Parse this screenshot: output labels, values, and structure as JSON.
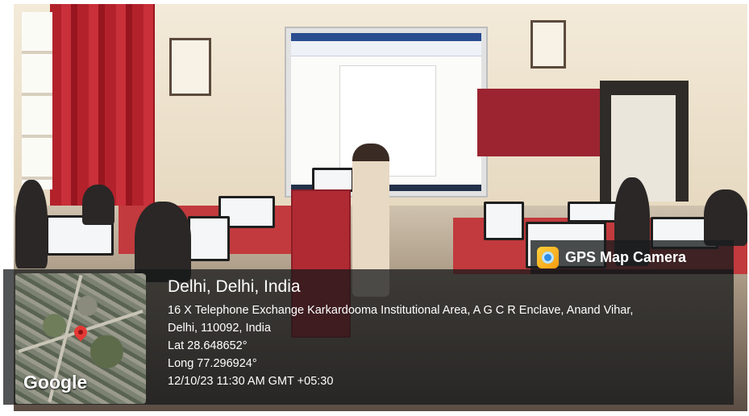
{
  "overlay": {
    "app_name": "GPS Map Camera",
    "city": "Delhi, Delhi, India",
    "address_line_1": "16 X Telephone Exchange Karkardooma Institutional Area, A G C R Enclave, Anand Vihar,",
    "address_line_2": "Delhi, 110092, India",
    "latitude": "Lat 28.648652°",
    "longitude": "Long 77.296924°",
    "timestamp": "12/10/23 11:30 AM GMT +05:30",
    "map_brand": "Google"
  },
  "icons": {
    "app_icon": "camera-globe-icon",
    "map_pin": "location-pin-icon"
  },
  "colors": {
    "overlay_bg": "#16181a",
    "pin": "#e53935",
    "curtain": "#b3222b"
  }
}
